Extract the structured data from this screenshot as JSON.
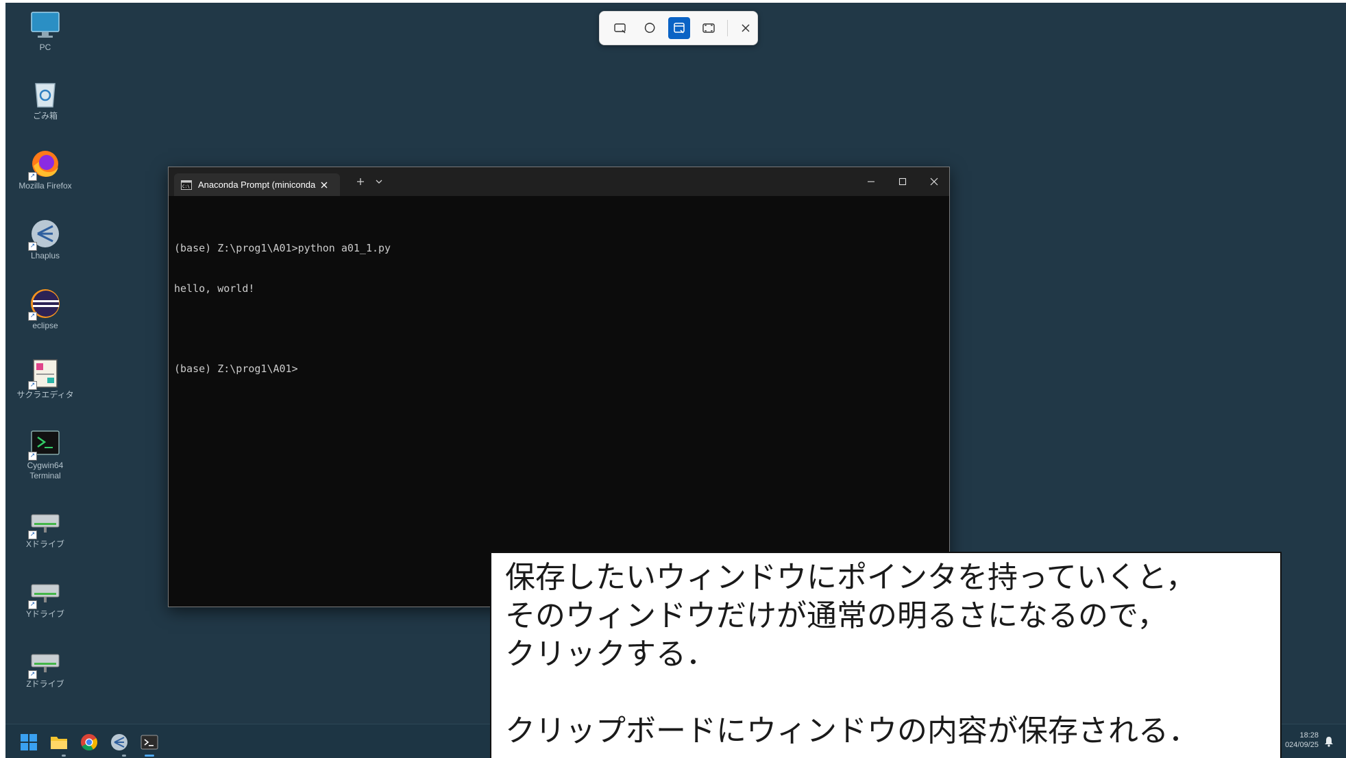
{
  "desktop": {
    "icons": [
      {
        "label": "PC",
        "icon": "monitor-icon"
      },
      {
        "label": "ごみ箱",
        "icon": "recycle-bin-icon"
      },
      {
        "label": "Mozilla Firefox",
        "icon": "firefox-icon"
      },
      {
        "label": "Lhaplus",
        "icon": "lhaplus-icon"
      },
      {
        "label": "eclipse",
        "icon": "eclipse-icon"
      },
      {
        "label": "サクラエディタ",
        "icon": "sakura-editor-icon"
      },
      {
        "label": "Cygwin64 Terminal",
        "icon": "cygwin-terminal-icon"
      },
      {
        "label": "Xドライブ",
        "icon": "network-drive-icon"
      },
      {
        "label": "Yドライブ",
        "icon": "network-drive-icon"
      },
      {
        "label": "Zドライブ",
        "icon": "network-drive-icon"
      }
    ],
    "background_color": "#213847"
  },
  "snipping_toolbar": {
    "modes": [
      "rectangle-snip-icon",
      "freeform-snip-icon",
      "window-snip-icon",
      "fullscreen-snip-icon"
    ],
    "active_mode": "window-snip-icon",
    "accent_color": "#0b63c5"
  },
  "terminal": {
    "tab_title": "Anaconda Prompt (miniconda",
    "lines": [
      "(base) Z:\\prog1\\A01>python a01_1.py",
      "hello, world!",
      "",
      "(base) Z:\\prog1\\A01>"
    ]
  },
  "taskbar": {
    "clock_time": "18:28",
    "clock_date": "024/09/25",
    "apps": [
      "windows-start-icon",
      "file-explorer-icon",
      "chrome-icon",
      "lhaplus-icon",
      "terminal-icon"
    ]
  },
  "callout": {
    "line1": "保存したいウィンドウにポインタを持っていくと，",
    "line2": "そのウィンドウだけが通常の明るさになるので，",
    "line3": "クリックする．",
    "line4": "クリップボードにウィンドウの内容が保存される．"
  }
}
